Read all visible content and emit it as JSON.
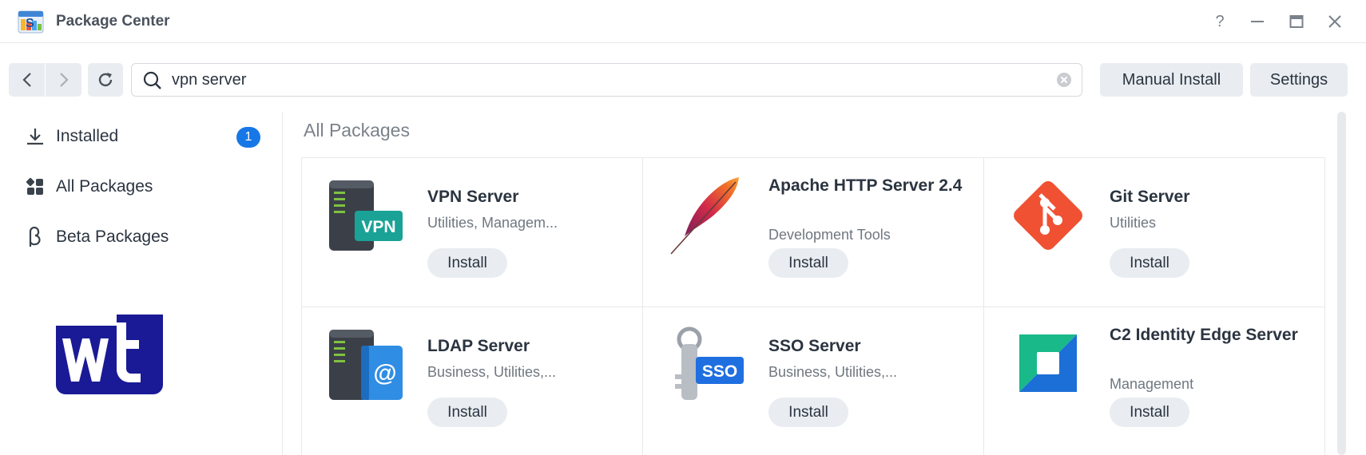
{
  "window": {
    "title": "Package Center",
    "controls": {
      "help": "?",
      "minimize": "—",
      "maximize": "▢",
      "close": "✕"
    }
  },
  "toolbar": {
    "search_value": "vpn server",
    "manual_install_label": "Manual Install",
    "settings_label": "Settings"
  },
  "sidebar": {
    "items": [
      {
        "label": "Installed",
        "icon": "download-icon",
        "badge": "1"
      },
      {
        "label": "All Packages",
        "icon": "grid-icon"
      },
      {
        "label": "Beta Packages",
        "icon": "beta-icon"
      }
    ],
    "logo": "wt-logo"
  },
  "main": {
    "title": "All Packages",
    "packages": [
      {
        "name": "VPN Server",
        "category": "Utilities, Managem...",
        "install_label": "Install",
        "icon": "vpn-server-icon"
      },
      {
        "name": "Apache HTTP Server 2.4",
        "category": "Development Tools",
        "install_label": "Install",
        "icon": "apache-feather-icon"
      },
      {
        "name": "Git Server",
        "category": "Utilities",
        "install_label": "Install",
        "icon": "git-icon"
      },
      {
        "name": "LDAP Server",
        "category": "Business, Utilities,...",
        "install_label": "Install",
        "icon": "ldap-server-icon"
      },
      {
        "name": "SSO Server",
        "category": "Business, Utilities,...",
        "install_label": "Install",
        "icon": "sso-key-icon"
      },
      {
        "name": "C2 Identity Edge Server",
        "category": "Management",
        "install_label": "Install",
        "icon": "c2-identity-icon"
      }
    ],
    "icon_text": {
      "vpn": "VPN",
      "ldap": "@",
      "sso": "SSO"
    }
  },
  "colors": {
    "accent": "#1777e6",
    "button_bg": "#e9edf1",
    "git": "#f05133",
    "logo_navy": "#1a1a96"
  }
}
